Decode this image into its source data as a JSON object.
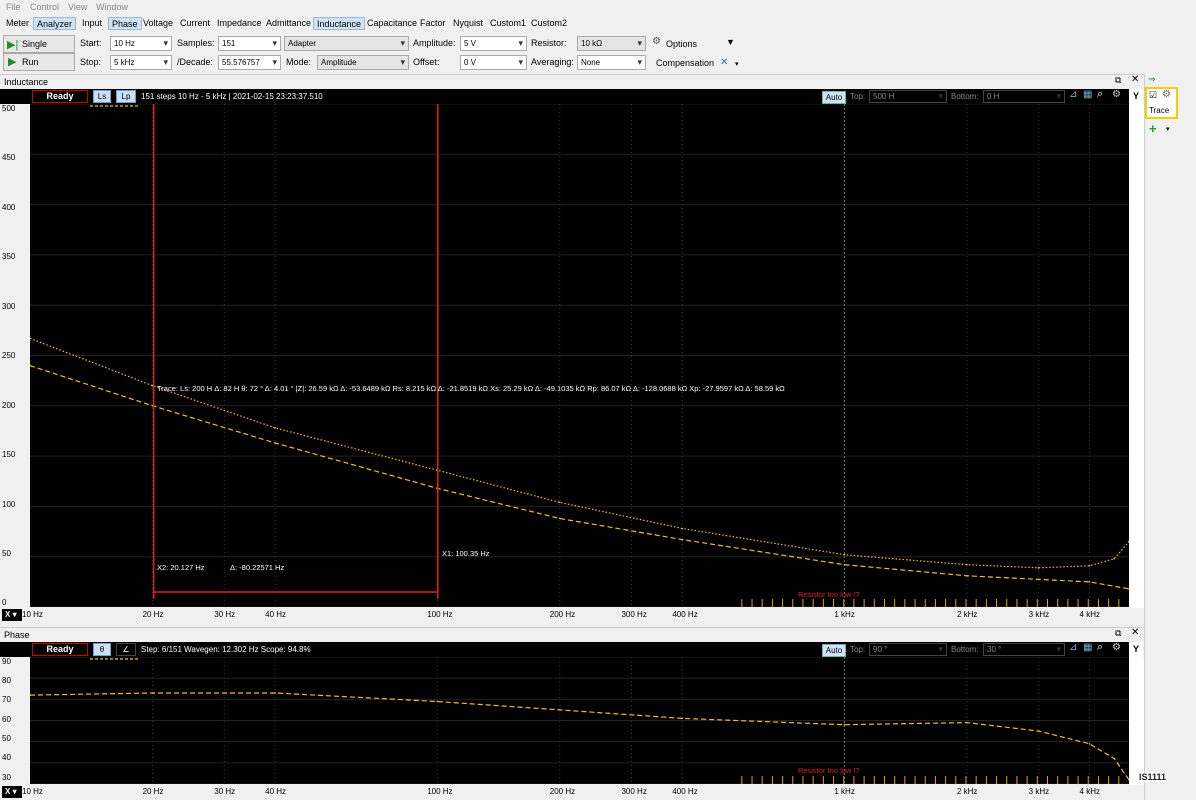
{
  "menu": [
    "File",
    "Control",
    "View",
    "Window"
  ],
  "tabs": [
    "Meter",
    "Analyzer",
    "Input",
    "Phase",
    "Voltage",
    "Current",
    "Impedance",
    "Admittance",
    "Inductance",
    "Capacitance",
    "Factor",
    "Nyquist",
    "Custom1",
    "Custom2"
  ],
  "selected_tabs": [
    "Analyzer",
    "Phase",
    "Inductance"
  ],
  "toolbar": {
    "single_label": "Single",
    "run_label": "Run",
    "start_label": "Start:",
    "start_value": "10 Hz",
    "stop_label": "Stop:",
    "stop_value": "5 kHz",
    "samples_label": "Samples:",
    "samples_value": "151",
    "decade_label": "/Decade:",
    "decade_value": "55.576757",
    "adapter_value": "Adapter",
    "mode_label": "Mode:",
    "mode_value": "Amplitude",
    "amplitude_label": "Amplitude:",
    "amplitude_value": "5 V",
    "offset_label": "Offset:",
    "offset_value": "0 V",
    "resistor_label": "Resistor:",
    "resistor_value": "10 kΩ",
    "averaging_label": "Averaging:",
    "averaging_value": "None",
    "options_label": "Options",
    "compensation_label": "Compensation"
  },
  "side": {
    "trace_label": "Trace"
  },
  "top_panel": {
    "title": "Inductance",
    "unit": "H",
    "status": "Ready",
    "btn_ls": "Ls",
    "btn_lp": "Lp",
    "info": "151 steps 10 Hz - 5 kHz | 2021-02-15 23:23:37.510",
    "auto": "Auto",
    "top_label": "Top:",
    "top_value": "500 H",
    "bottom_label": "Bottom:",
    "bottom_value": "0 H",
    "y_btn": "Y",
    "x_btn": "X",
    "y_ticks": [
      "500",
      "450",
      "400",
      "350",
      "300",
      "250",
      "200",
      "150",
      "100",
      "50",
      "0"
    ],
    "trace_readout": "Trace:     Ls: 200 H Δ: 82 H  θ: 72 ° Δ: 4.01 °  |Z|: 26.59 kΩ Δ: -53.6489 kΩ  Rs: 8.215 kΩ Δ: -21.8519 kΩ  Xs: 25.29 kΩ Δ: -49.1035 kΩ  Rp: 86.07 kΩ Δ: -128.0688 kΩ  Xp: -27.9597 kΩ Δ: 58.59 kΩ",
    "x1_label": "X1: 100.35 Hz",
    "x2_label": "X2: 20.127 Hz",
    "delta_label": "Δ: -80.22571 Hz",
    "warning": "Resistor too low !?"
  },
  "bottom_panel": {
    "title": "Phase",
    "unit": "°",
    "status": "Ready",
    "btn_theta": "θ",
    "btn_angle": "∠",
    "info": "Step: 6/151 Wavegen: 12.302 Hz  Scope: 94.8%",
    "auto": "Auto",
    "top_label": "Top:",
    "top_value": "90 °",
    "bottom_label": "Bottom:",
    "bottom_value": "30 °",
    "y_btn": "Y",
    "x_btn": "X",
    "y_ticks": [
      "90",
      "80",
      "70",
      "60",
      "50",
      "40",
      "30"
    ],
    "warning": "Resistor too low !?",
    "watermark": "IS1111"
  },
  "x_ticks": [
    "10 Hz",
    "20 Hz",
    "30 Hz",
    "40 Hz",
    "100 Hz",
    "200 Hz",
    "300 Hz",
    "400 Hz",
    "1 kHz",
    "2 kHz",
    "3 kHz",
    "4 kHz"
  ],
  "colors": {
    "trace": "#f0c020",
    "cursor": "#e02020",
    "plot_bg": "#000000",
    "grid": "#555555"
  },
  "chart_data": [
    {
      "type": "line",
      "title": "Inductance",
      "xscale": "log",
      "xlim": [
        10,
        5000
      ],
      "ylim": [
        0,
        500
      ],
      "series": [
        {
          "name": "Ls",
          "style": "dashed",
          "x": [
            10,
            20,
            40,
            100,
            200,
            400,
            1000,
            2000,
            4000,
            5000
          ],
          "y": [
            240,
            200,
            163,
            118,
            88,
            67,
            42,
            31,
            25,
            18
          ]
        },
        {
          "name": "Lp",
          "style": "dotted",
          "x": [
            10,
            20,
            40,
            100,
            200,
            400,
            1000,
            2000,
            3000,
            4000,
            4600,
            5000
          ],
          "y": [
            267,
            220,
            178,
            136,
            104,
            78,
            52,
            42,
            39,
            41,
            48,
            65
          ]
        }
      ],
      "cursors": [
        {
          "name": "X2",
          "x": 20.127
        },
        {
          "name": "X1",
          "x": 100.35
        }
      ]
    },
    {
      "type": "line",
      "title": "Phase",
      "xscale": "log",
      "xlim": [
        10,
        5000
      ],
      "ylim": [
        30,
        90
      ],
      "series": [
        {
          "name": "θ",
          "style": "dashed",
          "x": [
            10,
            20,
            40,
            100,
            200,
            400,
            1000,
            2000,
            3000,
            4000,
            4600,
            5000
          ],
          "y": [
            72,
            73,
            73,
            69,
            65,
            61,
            58,
            59,
            55,
            49,
            42,
            32
          ]
        }
      ]
    }
  ]
}
